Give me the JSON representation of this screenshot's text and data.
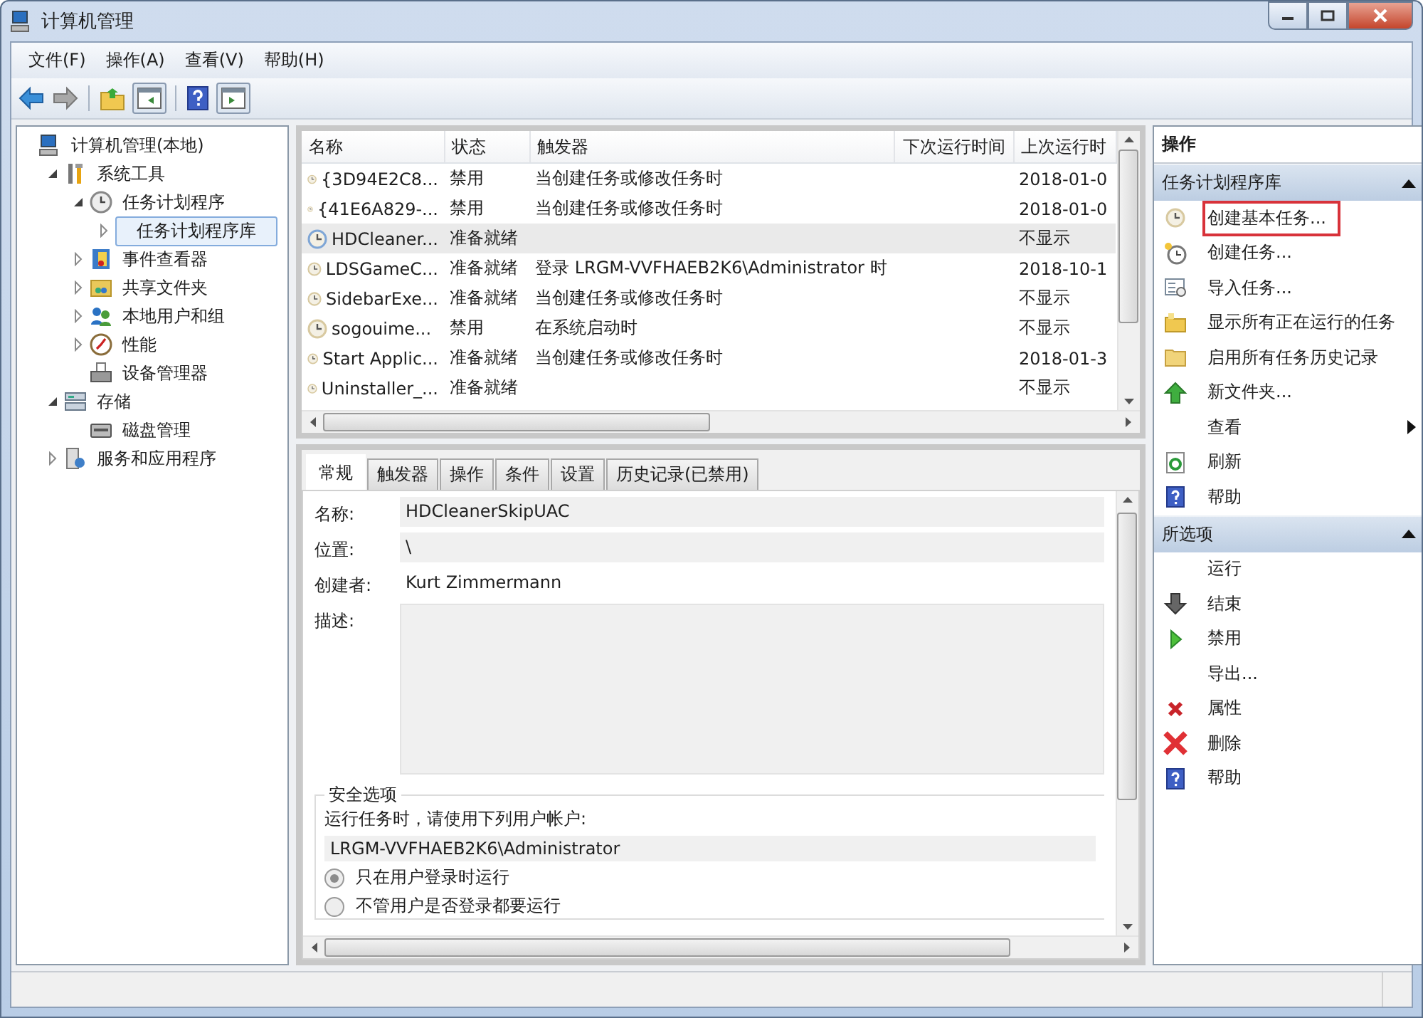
{
  "window": {
    "title": "计算机管理"
  },
  "menu": [
    "文件(F)",
    "操作(A)",
    "查看(V)",
    "帮助(H)"
  ],
  "tree": [
    {
      "label": "计算机管理(本地)",
      "kind": "computer",
      "children": [
        {
          "label": "系统工具",
          "kind": "tools",
          "expanded": true,
          "children": [
            {
              "label": "任务计划程序",
              "kind": "clock",
              "expanded": true,
              "children": [
                {
                  "label": "任务计划程序库",
                  "expanded": false,
                  "selected": true
                }
              ]
            },
            {
              "label": "事件查看器",
              "kind": "event",
              "expanded": false,
              "selected": false
            },
            {
              "label": "共享文件夹",
              "kind": "share",
              "expanded": false,
              "selected": false
            },
            {
              "label": "本地用户和组",
              "kind": "users",
              "expanded": false,
              "selected": false
            },
            {
              "label": "性能",
              "kind": "perf",
              "expanded": false,
              "selected": false
            },
            {
              "label": "设备管理器",
              "kind": "device",
              "selected": false
            }
          ]
        },
        {
          "label": "存储",
          "kind": "storage",
          "expanded": true,
          "children": [
            {
              "label": "磁盘管理",
              "kind": "disk",
              "selected": false
            }
          ]
        },
        {
          "label": "服务和应用程序",
          "kind": "services",
          "expanded": false,
          "selected": false
        }
      ]
    }
  ],
  "table": {
    "columns": [
      "名称",
      "状态",
      "触发器",
      "下次运行时间",
      "上次运行时"
    ],
    "rows": [
      {
        "cells": [
          "{3D94E2C8...",
          "禁用",
          "当创建任务或修改任务时",
          "",
          "2018-01-0"
        ],
        "selected": false
      },
      {
        "cells": [
          "{41E6A829-...",
          "禁用",
          "当创建任务或修改任务时",
          "",
          "2018-01-0"
        ],
        "selected": false
      },
      {
        "cells": [
          "HDCleaner...",
          "准备就绪",
          "",
          "",
          "不显示"
        ],
        "selected": true
      },
      {
        "cells": [
          "LDSGameC...",
          "准备就绪",
          "登录 LRGM-VVFHAEB2K6\\Administrator 时",
          "",
          "2018-10-1"
        ],
        "selected": false
      },
      {
        "cells": [
          "SidebarExe...",
          "准备就绪",
          "当创建任务或修改任务时",
          "",
          "不显示"
        ],
        "selected": false
      },
      {
        "cells": [
          "sogouime...",
          "禁用",
          "在系统启动时",
          "",
          "不显示"
        ],
        "selected": false
      },
      {
        "cells": [
          "Start Applic...",
          "准备就绪",
          "当创建任务或修改任务时",
          "",
          "2018-01-3"
        ],
        "selected": false
      },
      {
        "cells": [
          "Uninstaller_...",
          "准备就绪",
          "",
          "",
          "不显示"
        ],
        "selected": false
      }
    ]
  },
  "tabs": [
    {
      "label": "常规",
      "selected": true
    },
    {
      "label": "触发器",
      "selected": false
    },
    {
      "label": "操作",
      "selected": false
    },
    {
      "label": "条件",
      "selected": false
    },
    {
      "label": "设置",
      "selected": false
    },
    {
      "label": "历史记录(已禁用)",
      "selected": false
    }
  ],
  "general": {
    "name_label": "名称:",
    "name": "HDCleanerSkipUAC",
    "location_label": "位置:",
    "location": "\\",
    "author_label": "创建者:",
    "author": "Kurt Zimmermann",
    "description_label": "描述:",
    "security": {
      "legend": "安全选项",
      "prompt": "运行任务时，请使用下列用户帐户:",
      "account": "LRGM-VVFHAEB2K6\\Administrator",
      "options": [
        {
          "label": "只在用户登录时运行",
          "selected": true
        },
        {
          "label": "不管用户是否登录都要运行",
          "selected": false
        }
      ]
    }
  },
  "actions": {
    "title": "操作",
    "sections": [
      {
        "title": "任务计划程序库",
        "expanded": true,
        "items": [
          {
            "label": "创建基本任务...",
            "kind": "clock",
            "highlighted": true
          },
          {
            "label": "创建任务...",
            "kind": "clocknew",
            "highlighted": false
          },
          {
            "label": "导入任务...",
            "kind": "import",
            "highlighted": false
          },
          {
            "label": "显示所有正在运行的任务",
            "kind": "folderopen",
            "highlighted": false
          },
          {
            "label": "启用所有任务历史记录",
            "kind": "folder",
            "highlighted": false
          },
          {
            "label": "新文件夹...",
            "kind": "up",
            "highlighted": false
          },
          {
            "label": "查看",
            "kind": "submenu",
            "highlighted": false
          },
          {
            "label": "刷新",
            "kind": "refresh",
            "highlighted": false
          },
          {
            "label": "帮助",
            "kind": "help",
            "highlighted": false
          }
        ]
      },
      {
        "title": "所选项",
        "expanded": true,
        "items": [
          {
            "label": "运行",
            "kind": "none",
            "highlighted": false
          },
          {
            "label": "结束",
            "kind": "down",
            "highlighted": false
          },
          {
            "label": "禁用",
            "kind": "play",
            "highlighted": false
          },
          {
            "label": "导出...",
            "kind": "none",
            "highlighted": false
          },
          {
            "label": "属性",
            "kind": "xsmall",
            "highlighted": false
          },
          {
            "label": "删除",
            "kind": "xbig",
            "highlighted": false
          },
          {
            "label": "帮助",
            "kind": "help",
            "highlighted": false
          }
        ]
      }
    ]
  }
}
